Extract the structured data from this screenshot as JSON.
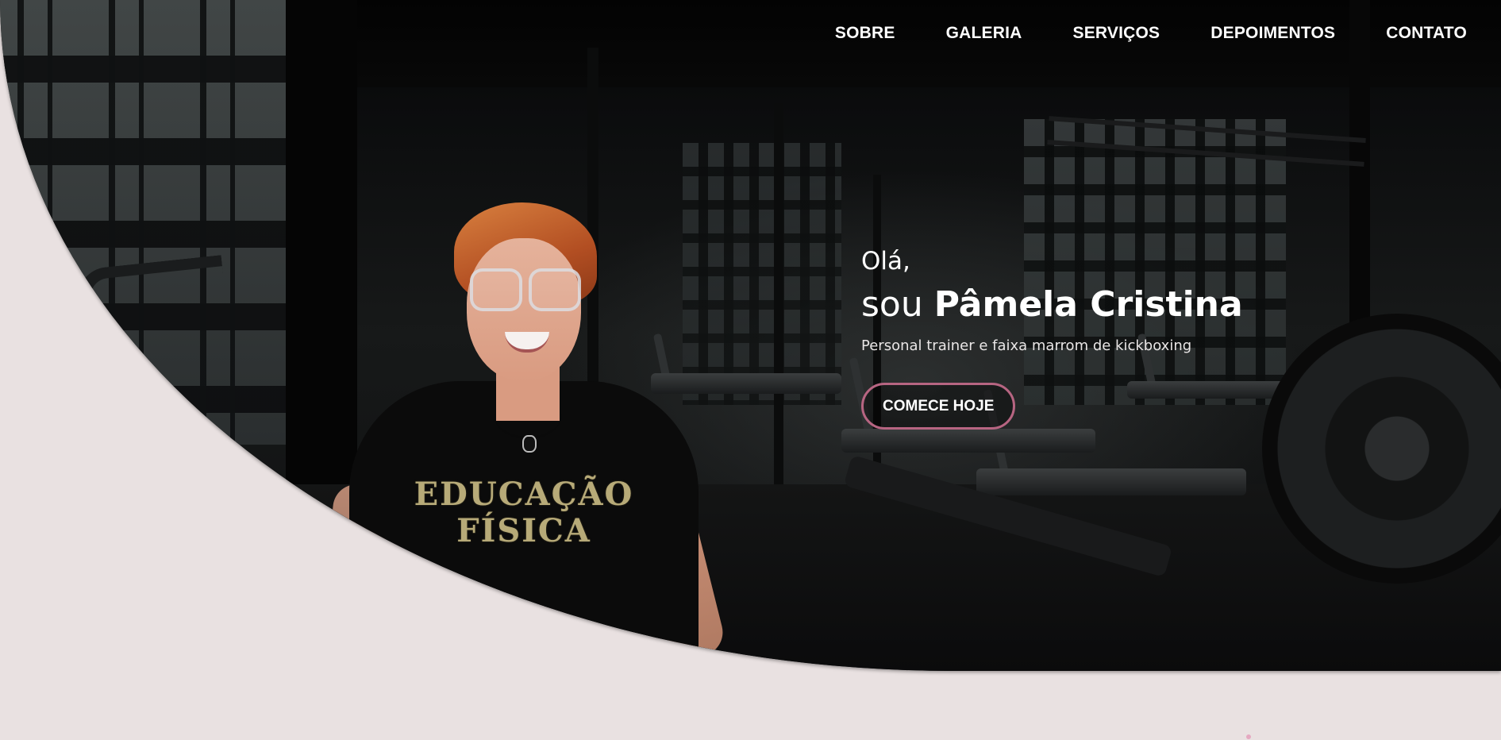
{
  "nav": {
    "items": [
      {
        "label": "SOBRE"
      },
      {
        "label": "GALERIA"
      },
      {
        "label": "SERVIÇOS"
      },
      {
        "label": "DEPOIMENTOS"
      },
      {
        "label": "CONTATO"
      }
    ]
  },
  "hero": {
    "greeting": "Olá,",
    "intro_prefix": "sou",
    "name": "Pâmela Cristina",
    "subtitle": "Personal trainer e faixa marrom de kickboxing",
    "cta_label": "COMECE HOJE",
    "shirt_text_line1": "EDUCAÇÃO",
    "shirt_text_line2": "FÍSICA"
  },
  "colors": {
    "page_background": "#e9e1e1",
    "accent": "#b76582",
    "hero_dark": "#0b0c0d",
    "text_light": "#ffffff"
  }
}
